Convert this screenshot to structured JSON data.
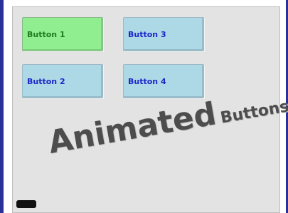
{
  "buttons": [
    {
      "label": "Button 1",
      "state": "active"
    },
    {
      "label": "Button 3",
      "state": "normal"
    },
    {
      "label": "Button 2",
      "state": "normal"
    },
    {
      "label": "Button 4",
      "state": "normal"
    }
  ],
  "title": {
    "first": "Animated",
    "second": "Buttons"
  },
  "colors": {
    "active_bg": "#90ee90",
    "active_text": "#1f7a1f",
    "normal_bg": "#add8e6",
    "normal_text": "#1c27c9",
    "panel_bg": "#e3e3e3",
    "frame_border": "#2b2f9a"
  },
  "icons": {
    "status_indicator": "status-indicator-icon"
  }
}
